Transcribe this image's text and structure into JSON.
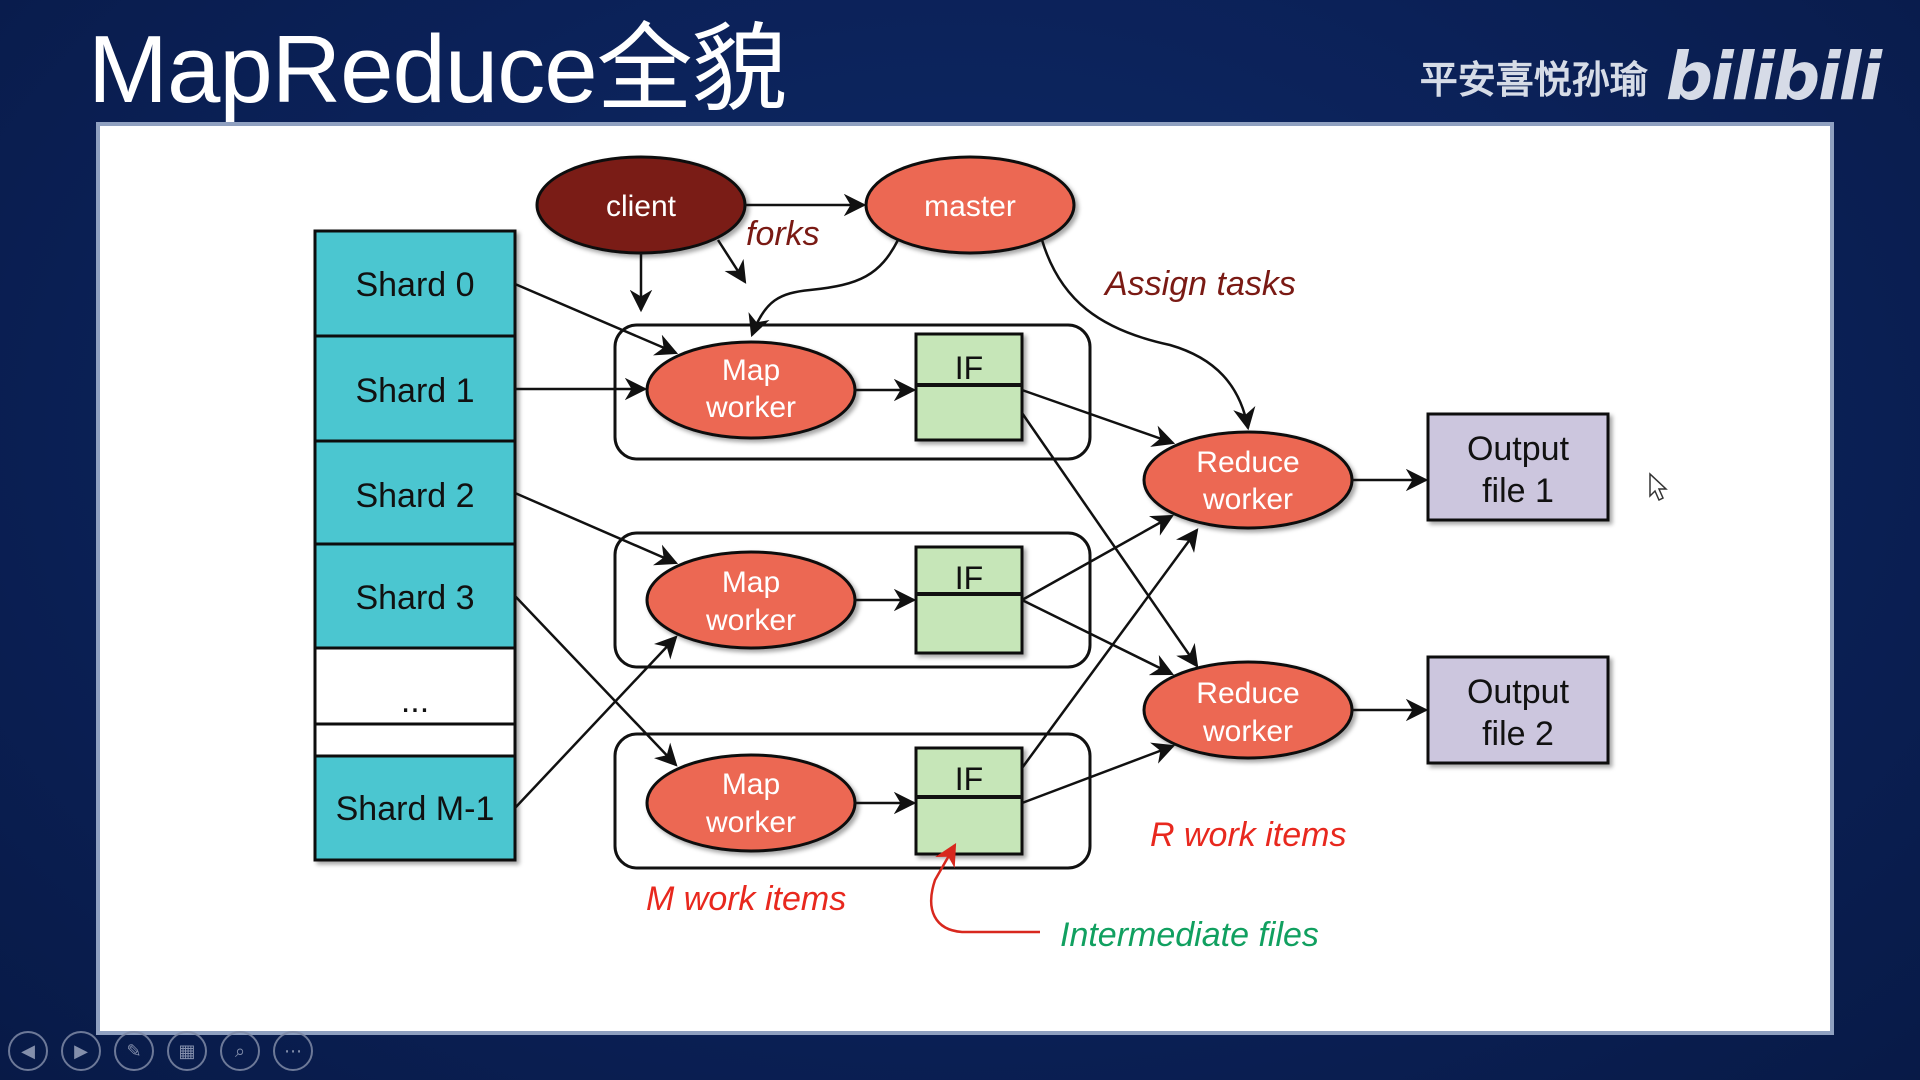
{
  "slide": {
    "title": "MapReduce全貌",
    "watermark_author": "平安喜悦孙瑜",
    "watermark_logo": "bilibili"
  },
  "diagram": {
    "client": "client",
    "master": "master",
    "forks": "forks",
    "assign_tasks": "Assign tasks",
    "shards": [
      "Shard 0",
      "Shard 1",
      "Shard 2",
      "Shard 3",
      "...",
      "",
      "Shard M-1"
    ],
    "map_worker": [
      "Map",
      "worker"
    ],
    "intermediate_file": "IF",
    "reduce_worker": [
      "Reduce",
      "worker"
    ],
    "output_files": [
      [
        "Output",
        "file 1"
      ],
      [
        "Output",
        "file 2"
      ]
    ],
    "m_work_items": "M work items",
    "r_work_items": "R work items",
    "intermediate_files": "Intermediate files",
    "colors": {
      "shard_fill": "#4bc6d0",
      "client_fill": "#7a1f18",
      "worker_fill": "#ec6852",
      "if_fill": "#c6e6b8",
      "output_fill": "#ccc6de",
      "label_dark_red": "#7a1a14",
      "label_red": "#e8281e",
      "label_green": "#11a060"
    }
  },
  "nav": {
    "icons": [
      "prev-icon",
      "next-icon",
      "pen-icon",
      "slides-icon",
      "zoom-icon",
      "more-icon"
    ]
  }
}
